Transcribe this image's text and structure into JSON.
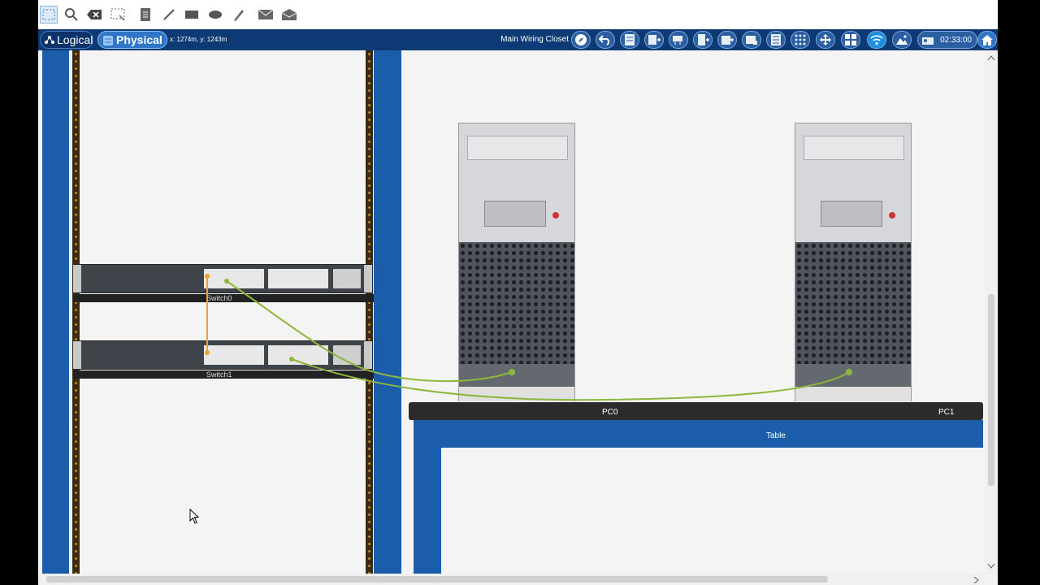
{
  "toolbar": {
    "icons": [
      "select-icon",
      "inspect-icon",
      "delete-icon",
      "resize-icon",
      "note-icon",
      "line-icon",
      "rectangle-icon",
      "ellipse-icon",
      "freeform-icon",
      "simple-pdu-icon",
      "complex-pdu-icon"
    ]
  },
  "navbar": {
    "logical_tab": "Logical",
    "physical_tab": "Physical",
    "coordinates": "x: 1274m, y: 1243m",
    "location": "Main Wiring Closet",
    "clock": "02:33:00"
  },
  "workspace": {
    "switch0_label": "Switch0",
    "switch1_label": "Switch1",
    "pc0_label": "PC0",
    "pc1_label": "PC1",
    "table_label": "Table"
  },
  "colors": {
    "navbar": "#0d3a74",
    "rack_blue": "#1b5cab",
    "cable_green": "#8db63c",
    "cable_orange": "#f0a12a"
  }
}
